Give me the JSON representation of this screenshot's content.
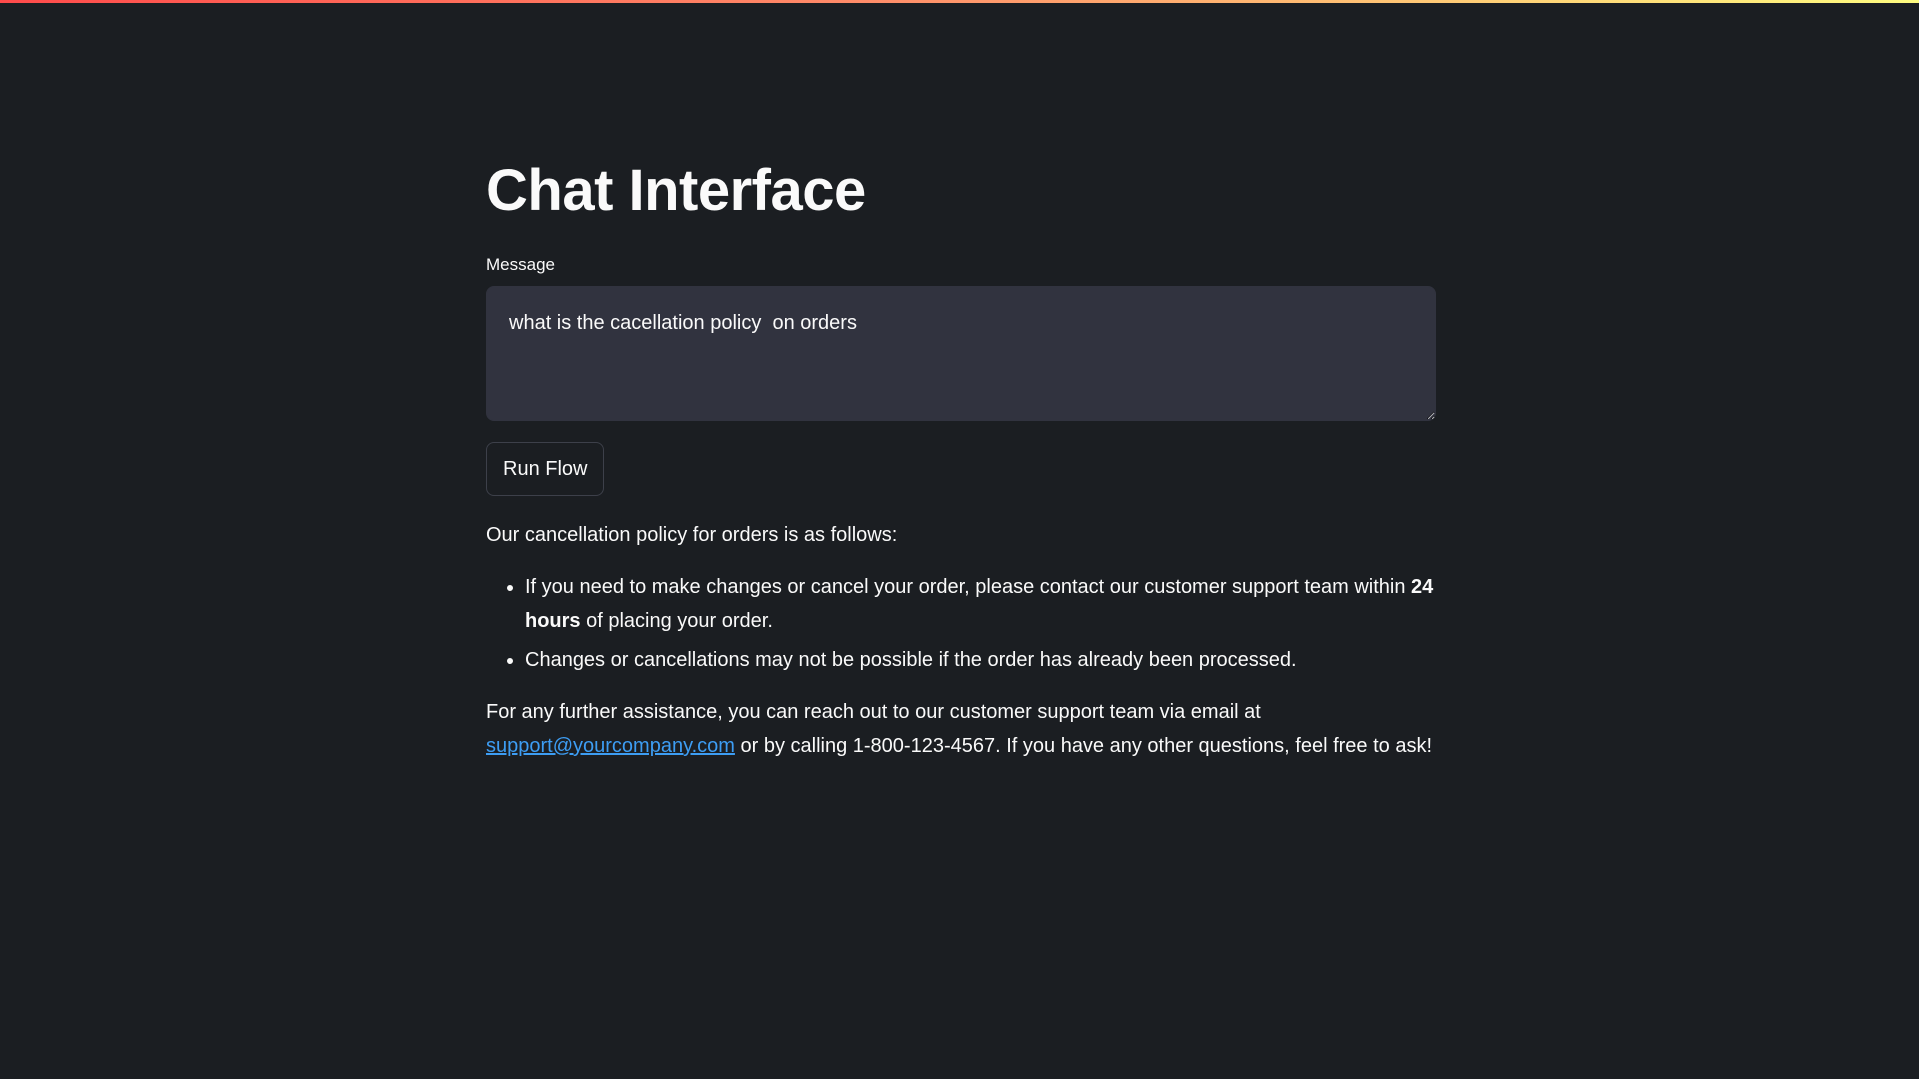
{
  "page": {
    "title": "Chat Interface"
  },
  "form": {
    "message_label": "Message",
    "message_value": "what is the cacellation policy  on orders",
    "run_button_label": "Run Flow"
  },
  "response": {
    "intro": "Our cancellation policy for orders is as follows:",
    "bullets": [
      {
        "text_before": "If you need to make changes or cancel your order, please contact our customer support team within ",
        "bold": "24 hours",
        "text_after": " of placing your order."
      },
      {
        "text": "Changes or cancellations may not be possible if the order has already been processed."
      }
    ],
    "closing_before": "For any further assistance, you can reach out to our customer support team via email at ",
    "email_link": "support@yourcompany.com",
    "closing_after": " or by calling 1-800-123-4567. If you have any other questions, feel free to ask!"
  },
  "colors": {
    "background": "#1b1e22",
    "input_bg": "#31333f",
    "link": "#3d9df3",
    "accent_gradient_start": "#ff4b4b",
    "accent_gradient_end": "#fffd80"
  }
}
